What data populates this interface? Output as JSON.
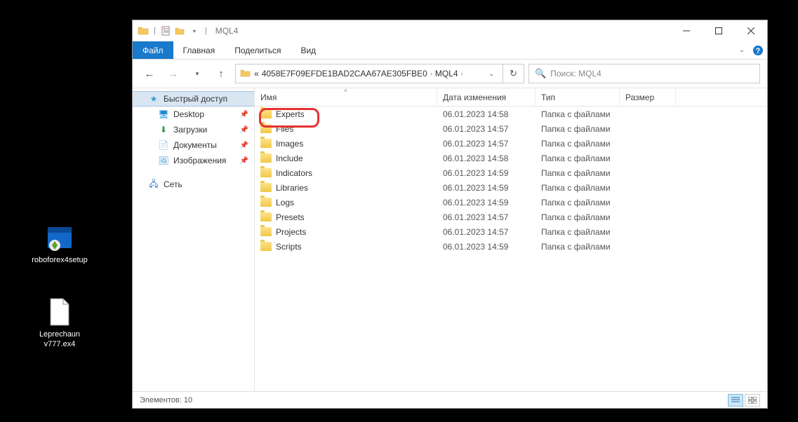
{
  "desktop": {
    "icons": [
      {
        "name": "roboforex4setup"
      },
      {
        "name": "Leprechaun v777.ex4"
      }
    ]
  },
  "window": {
    "title": "MQL4",
    "tabs": {
      "file": "Файл",
      "home": "Главная",
      "share": "Поделиться",
      "view": "Вид"
    },
    "breadcrumb": {
      "prefix": "«",
      "seg1": "4058E7F09EFDE1BAD2CAA67AE305FBE0",
      "seg2": "MQL4"
    },
    "search_placeholder": "Поиск: MQL4",
    "nav": {
      "quick_access": "Быстрый доступ",
      "desktop": "Desktop",
      "downloads": "Загрузки",
      "documents": "Документы",
      "pictures": "Изображения",
      "network": "Сеть"
    },
    "columns": {
      "name": "Имя",
      "date": "Дата изменения",
      "type": "Тип",
      "size": "Размер"
    },
    "type_folder": "Папка с файлами",
    "items": [
      {
        "name": "Experts",
        "date": "06.01.2023 14:58"
      },
      {
        "name": "Files",
        "date": "06.01.2023 14:57"
      },
      {
        "name": "Images",
        "date": "06.01.2023 14:57"
      },
      {
        "name": "Include",
        "date": "06.01.2023 14:58"
      },
      {
        "name": "Indicators",
        "date": "06.01.2023 14:59"
      },
      {
        "name": "Libraries",
        "date": "06.01.2023 14:59"
      },
      {
        "name": "Logs",
        "date": "06.01.2023 14:59"
      },
      {
        "name": "Presets",
        "date": "06.01.2023 14:57"
      },
      {
        "name": "Projects",
        "date": "06.01.2023 14:57"
      },
      {
        "name": "Scripts",
        "date": "06.01.2023 14:59"
      }
    ],
    "status": "Элементов: 10"
  }
}
